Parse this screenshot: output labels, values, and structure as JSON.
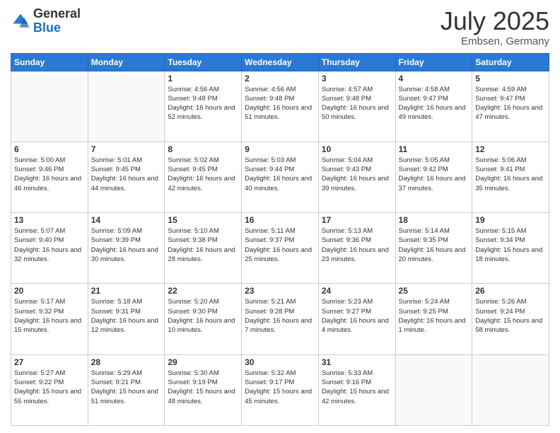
{
  "logo": {
    "general": "General",
    "blue": "Blue"
  },
  "header": {
    "month": "July 2025",
    "location": "Embsen, Germany"
  },
  "weekdays": [
    "Sunday",
    "Monday",
    "Tuesday",
    "Wednesday",
    "Thursday",
    "Friday",
    "Saturday"
  ],
  "weeks": [
    [
      {
        "day": "",
        "info": ""
      },
      {
        "day": "",
        "info": ""
      },
      {
        "day": "1",
        "info": "Sunrise: 4:56 AM\nSunset: 9:48 PM\nDaylight: 16 hours and 52 minutes."
      },
      {
        "day": "2",
        "info": "Sunrise: 4:56 AM\nSunset: 9:48 PM\nDaylight: 16 hours and 51 minutes."
      },
      {
        "day": "3",
        "info": "Sunrise: 4:57 AM\nSunset: 9:48 PM\nDaylight: 16 hours and 50 minutes."
      },
      {
        "day": "4",
        "info": "Sunrise: 4:58 AM\nSunset: 9:47 PM\nDaylight: 16 hours and 49 minutes."
      },
      {
        "day": "5",
        "info": "Sunrise: 4:59 AM\nSunset: 9:47 PM\nDaylight: 16 hours and 47 minutes."
      }
    ],
    [
      {
        "day": "6",
        "info": "Sunrise: 5:00 AM\nSunset: 9:46 PM\nDaylight: 16 hours and 46 minutes."
      },
      {
        "day": "7",
        "info": "Sunrise: 5:01 AM\nSunset: 9:45 PM\nDaylight: 16 hours and 44 minutes."
      },
      {
        "day": "8",
        "info": "Sunrise: 5:02 AM\nSunset: 9:45 PM\nDaylight: 16 hours and 42 minutes."
      },
      {
        "day": "9",
        "info": "Sunrise: 5:03 AM\nSunset: 9:44 PM\nDaylight: 16 hours and 40 minutes."
      },
      {
        "day": "10",
        "info": "Sunrise: 5:04 AM\nSunset: 9:43 PM\nDaylight: 16 hours and 39 minutes."
      },
      {
        "day": "11",
        "info": "Sunrise: 5:05 AM\nSunset: 9:42 PM\nDaylight: 16 hours and 37 minutes."
      },
      {
        "day": "12",
        "info": "Sunrise: 5:06 AM\nSunset: 9:41 PM\nDaylight: 16 hours and 35 minutes."
      }
    ],
    [
      {
        "day": "13",
        "info": "Sunrise: 5:07 AM\nSunset: 9:40 PM\nDaylight: 16 hours and 32 minutes."
      },
      {
        "day": "14",
        "info": "Sunrise: 5:09 AM\nSunset: 9:39 PM\nDaylight: 16 hours and 30 minutes."
      },
      {
        "day": "15",
        "info": "Sunrise: 5:10 AM\nSunset: 9:38 PM\nDaylight: 16 hours and 28 minutes."
      },
      {
        "day": "16",
        "info": "Sunrise: 5:11 AM\nSunset: 9:37 PM\nDaylight: 16 hours and 25 minutes."
      },
      {
        "day": "17",
        "info": "Sunrise: 5:13 AM\nSunset: 9:36 PM\nDaylight: 16 hours and 23 minutes."
      },
      {
        "day": "18",
        "info": "Sunrise: 5:14 AM\nSunset: 9:35 PM\nDaylight: 16 hours and 20 minutes."
      },
      {
        "day": "19",
        "info": "Sunrise: 5:15 AM\nSunset: 9:34 PM\nDaylight: 16 hours and 18 minutes."
      }
    ],
    [
      {
        "day": "20",
        "info": "Sunrise: 5:17 AM\nSunset: 9:32 PM\nDaylight: 16 hours and 15 minutes."
      },
      {
        "day": "21",
        "info": "Sunrise: 5:18 AM\nSunset: 9:31 PM\nDaylight: 16 hours and 12 minutes."
      },
      {
        "day": "22",
        "info": "Sunrise: 5:20 AM\nSunset: 9:30 PM\nDaylight: 16 hours and 10 minutes."
      },
      {
        "day": "23",
        "info": "Sunrise: 5:21 AM\nSunset: 9:28 PM\nDaylight: 16 hours and 7 minutes."
      },
      {
        "day": "24",
        "info": "Sunrise: 5:23 AM\nSunset: 9:27 PM\nDaylight: 16 hours and 4 minutes."
      },
      {
        "day": "25",
        "info": "Sunrise: 5:24 AM\nSunset: 9:25 PM\nDaylight: 16 hours and 1 minute."
      },
      {
        "day": "26",
        "info": "Sunrise: 5:26 AM\nSunset: 9:24 PM\nDaylight: 15 hours and 58 minutes."
      }
    ],
    [
      {
        "day": "27",
        "info": "Sunrise: 5:27 AM\nSunset: 9:22 PM\nDaylight: 15 hours and 55 minutes."
      },
      {
        "day": "28",
        "info": "Sunrise: 5:29 AM\nSunset: 9:21 PM\nDaylight: 15 hours and 51 minutes."
      },
      {
        "day": "29",
        "info": "Sunrise: 5:30 AM\nSunset: 9:19 PM\nDaylight: 15 hours and 48 minutes."
      },
      {
        "day": "30",
        "info": "Sunrise: 5:32 AM\nSunset: 9:17 PM\nDaylight: 15 hours and 45 minutes."
      },
      {
        "day": "31",
        "info": "Sunrise: 5:33 AM\nSunset: 9:16 PM\nDaylight: 15 hours and 42 minutes."
      },
      {
        "day": "",
        "info": ""
      },
      {
        "day": "",
        "info": ""
      }
    ]
  ]
}
